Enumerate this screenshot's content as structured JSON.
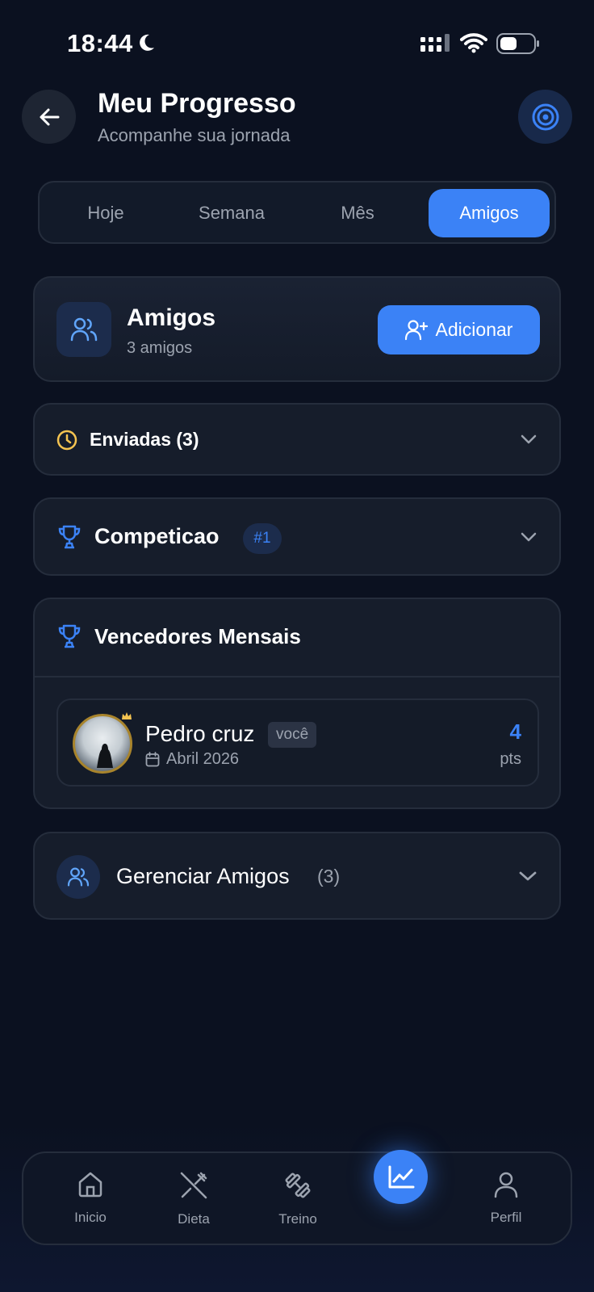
{
  "status": {
    "time": "18:44"
  },
  "header": {
    "title": "Meu Progresso",
    "subtitle": "Acompanhe sua jornada"
  },
  "tabs": [
    {
      "label": "Hoje",
      "active": false
    },
    {
      "label": "Semana",
      "active": false
    },
    {
      "label": "Mês",
      "active": false
    },
    {
      "label": "Amigos",
      "active": true
    }
  ],
  "friends": {
    "title": "Amigos",
    "count": "3 amigos",
    "add_label": "Adicionar"
  },
  "sent": {
    "label": "Enviadas (3)"
  },
  "competition": {
    "label": "Competicao",
    "rank": "#1"
  },
  "winners": {
    "title": "Vencedores Mensais",
    "entries": [
      {
        "name": "Pedro cruz",
        "badge": "você",
        "date": "Abril 2026",
        "points": "4",
        "points_label": "pts"
      }
    ]
  },
  "manage": {
    "label": "Gerenciar Amigos",
    "count": "(3)"
  },
  "nav": [
    {
      "label": "Inicio",
      "icon": "home-icon"
    },
    {
      "label": "Dieta",
      "icon": "utensils-icon"
    },
    {
      "label": "Treino",
      "icon": "dumbbell-icon"
    },
    {
      "label": "",
      "icon": "chart-icon",
      "active": true
    },
    {
      "label": "Perfil",
      "icon": "user-icon"
    }
  ],
  "colors": {
    "accent": "#3b82f6",
    "background": "#0b1120",
    "card": "#161d2b",
    "warning": "#f5c451"
  }
}
